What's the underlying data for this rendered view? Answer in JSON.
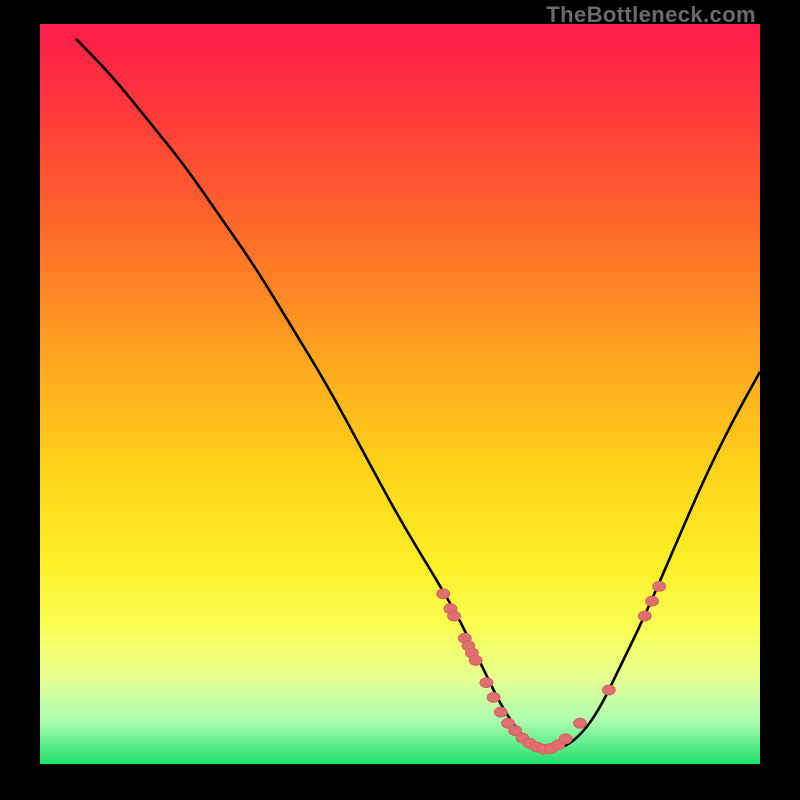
{
  "watermark": "TheBottleneck.com",
  "colors": {
    "curve": "#000000",
    "marker": "#e07070",
    "marker_stroke": "#d45b5b"
  },
  "chart_data": {
    "type": "line",
    "title": "",
    "xlabel": "",
    "ylabel": "",
    "xlim": [
      0,
      100
    ],
    "ylim": [
      0,
      100
    ],
    "curve": {
      "x": [
        5,
        10,
        15,
        20,
        25,
        30,
        35,
        40,
        45,
        50,
        55,
        58,
        60,
        62,
        64,
        66,
        68,
        70,
        72,
        74,
        76,
        78,
        80,
        84,
        88,
        92,
        96,
        100
      ],
      "y": [
        98,
        93,
        87,
        81,
        74,
        67,
        59,
        51,
        42,
        33,
        25,
        20,
        16,
        12,
        8,
        5,
        3,
        2,
        2,
        3,
        5,
        8,
        12,
        20,
        29,
        38,
        46,
        53
      ]
    },
    "markers": [
      {
        "x": 56,
        "y": 23
      },
      {
        "x": 57,
        "y": 21
      },
      {
        "x": 57.5,
        "y": 20
      },
      {
        "x": 59,
        "y": 17
      },
      {
        "x": 59.5,
        "y": 16
      },
      {
        "x": 60,
        "y": 15
      },
      {
        "x": 60.5,
        "y": 14
      },
      {
        "x": 62,
        "y": 11
      },
      {
        "x": 63,
        "y": 9
      },
      {
        "x": 64,
        "y": 7
      },
      {
        "x": 65,
        "y": 5.5
      },
      {
        "x": 66,
        "y": 4.5
      },
      {
        "x": 67,
        "y": 3.5
      },
      {
        "x": 68,
        "y": 2.8
      },
      {
        "x": 69,
        "y": 2.3
      },
      {
        "x": 70,
        "y": 2
      },
      {
        "x": 71,
        "y": 2.1
      },
      {
        "x": 72,
        "y": 2.6
      },
      {
        "x": 73,
        "y": 3.4
      },
      {
        "x": 75,
        "y": 5.5
      },
      {
        "x": 79,
        "y": 10
      },
      {
        "x": 84,
        "y": 20
      },
      {
        "x": 85,
        "y": 22
      },
      {
        "x": 86,
        "y": 24
      }
    ]
  }
}
